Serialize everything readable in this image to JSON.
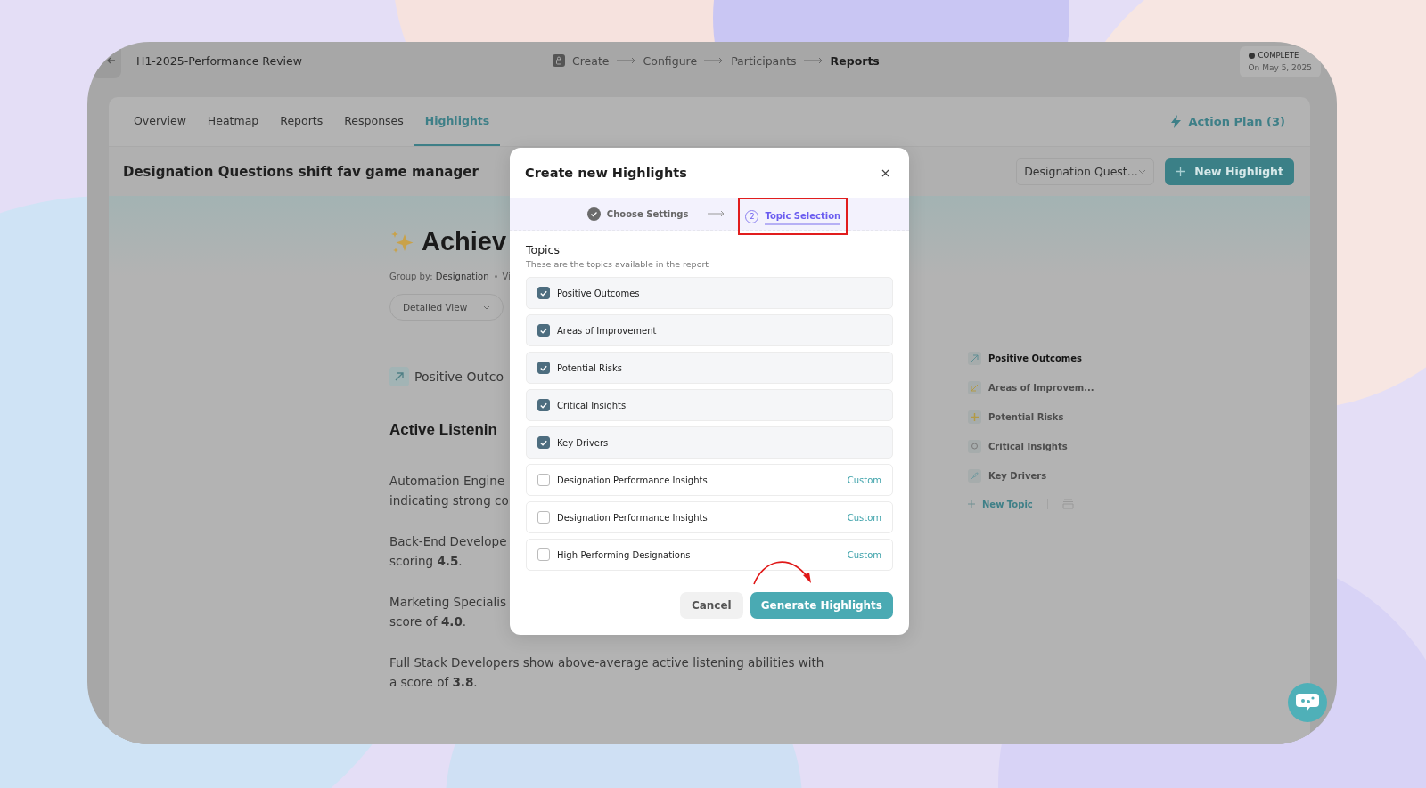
{
  "header": {
    "title": "H1-2025-Performance Review",
    "steps": [
      {
        "label": "Create",
        "kind": "icon",
        "selected": false
      },
      {
        "label": "Configure",
        "kind": "plain",
        "selected": false
      },
      {
        "label": "Participants",
        "kind": "plain",
        "selected": false
      },
      {
        "label": "Reports",
        "kind": "plain",
        "selected": true
      }
    ],
    "status": {
      "label": "COMPLETE",
      "date": "On May 5, 2025"
    }
  },
  "tabs": [
    {
      "label": "Overview",
      "selected": false
    },
    {
      "label": "Heatmap",
      "selected": false
    },
    {
      "label": "Reports",
      "selected": false
    },
    {
      "label": "Responses",
      "selected": false
    },
    {
      "label": "Highlights",
      "selected": true
    }
  ],
  "action_plan": "Action Plan (3)",
  "subheader": {
    "title": "Designation Questions shift fav game manager",
    "dropdown": "Designation Quest...",
    "button": "New Highlight"
  },
  "report": {
    "heading": "Achiev",
    "group_label": "Group by:",
    "group_value": "Designation",
    "view_label": "Vi",
    "view_dropdown": "Detailed View",
    "section": "Positive Outco",
    "subtitle": "Active Listenin",
    "paragraphs": [
      [
        "Automation Engine",
        "indicating strong co"
      ],
      [
        "Back-End Develope",
        "scoring **4.5**."
      ],
      [
        "Marketing Specialis",
        "score of **4.0**."
      ],
      [
        "Full Stack Developers show above-average active listening abilities with",
        "a score of **3.8**."
      ]
    ]
  },
  "sidebar": {
    "items": [
      {
        "label": "Positive Outcomes",
        "kind": "up",
        "selected": true
      },
      {
        "label": "Areas of Improvem...",
        "kind": "down",
        "selected": false
      },
      {
        "label": "Potential Risks",
        "kind": "risk",
        "selected": false
      },
      {
        "label": "Critical Insights",
        "kind": "bulb",
        "selected": false
      },
      {
        "label": "Key Drivers",
        "kind": "rocket",
        "selected": false
      }
    ],
    "new_topic": "New Topic"
  },
  "modal": {
    "title": "Create new Highlights",
    "steps": [
      {
        "label": "Choose Settings",
        "done": true,
        "selected": false,
        "highlighted": false
      },
      {
        "label": "Topic Selection",
        "number": "2",
        "done": false,
        "selected": true,
        "highlighted": true
      }
    ],
    "topics_title": "Topics",
    "topics_hint": "These are the topics available in the report",
    "topics": [
      {
        "label": "Positive Outcomes",
        "checked": true
      },
      {
        "label": "Areas of Improvement",
        "checked": true
      },
      {
        "label": "Potential Risks",
        "checked": true
      },
      {
        "label": "Critical Insights",
        "checked": true
      },
      {
        "label": "Key Drivers",
        "checked": true
      },
      {
        "label": "Designation Performance Insights",
        "checked": false,
        "tag": "Custom"
      },
      {
        "label": "Designation Performance Insights",
        "checked": false,
        "tag": "Custom"
      },
      {
        "label": "High-Performing Designations",
        "checked": false,
        "tag": "Custom"
      }
    ],
    "cancel": "Cancel",
    "primary": "Generate Highlights",
    "arrow_to_primary": true
  }
}
